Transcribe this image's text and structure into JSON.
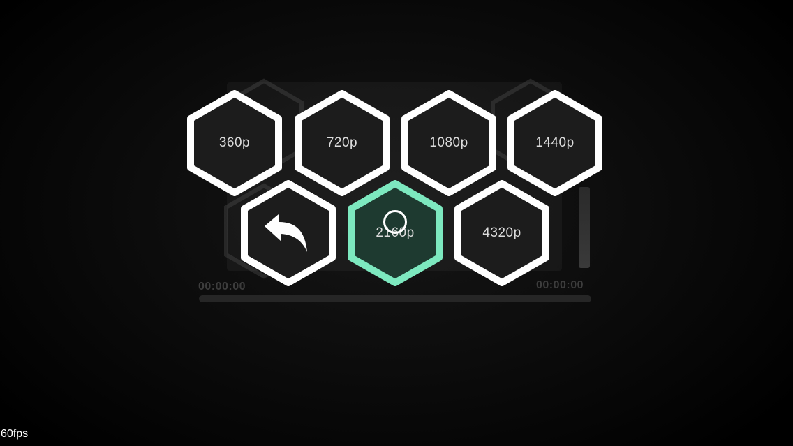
{
  "theme": {
    "hex_border": "#ffffff",
    "hex_fill": "#1c1c1c",
    "selected_border": "#7de8bf",
    "selected_fill": "#1e3a30",
    "label_color": "#dcdcdc"
  },
  "resolution_menu": {
    "row1": [
      {
        "label": "360p"
      },
      {
        "label": "720p"
      },
      {
        "label": "1080p"
      },
      {
        "label": "1440p"
      }
    ],
    "row2": [
      {
        "label": "",
        "icon": "back-arrow-icon"
      },
      {
        "label": "2160p",
        "selected": true
      },
      {
        "label": "4320p"
      }
    ]
  },
  "player": {
    "time_current": "00:00:00",
    "time_total": "00:00:00"
  },
  "overlay": {
    "fps_counter": "60fps"
  }
}
